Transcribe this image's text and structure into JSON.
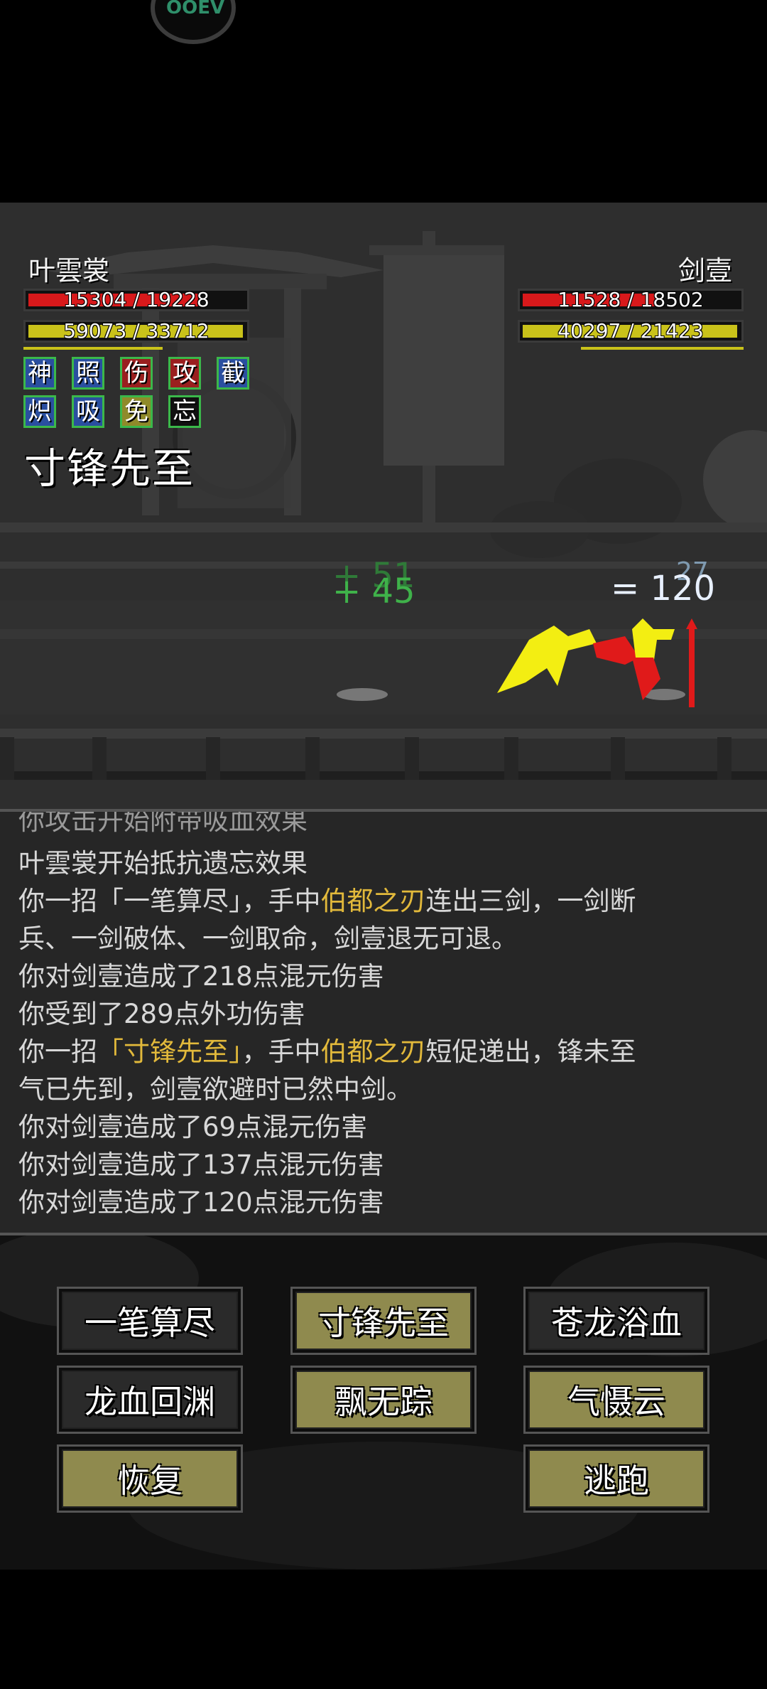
{
  "medal": {
    "text": "OOEV"
  },
  "player": {
    "name": "叶雲裳",
    "hp": "15304 / 19228",
    "hp_fraction": 0.79,
    "mp": "59073 / 33712",
    "mp_fraction": 1.0
  },
  "enemy": {
    "name": "剑壹",
    "hp": "11528 / 18502",
    "hp_fraction": 0.62,
    "mp": "40297 / 21423",
    "mp_fraction": 1.0
  },
  "buffs": [
    {
      "char": "神",
      "color": "#2a4fa0"
    },
    {
      "char": "照",
      "color": "#2a4fa0"
    },
    {
      "char": "伤",
      "color": "#9a1f1f"
    },
    {
      "char": "攻",
      "color": "#9a1f1f"
    },
    {
      "char": "截",
      "color": "#2a4fa0"
    },
    {
      "char": "炽",
      "color": "#2a4fa0"
    },
    {
      "char": "吸",
      "color": "#2a4fa0"
    },
    {
      "char": "免",
      "color": "#8f8a2a"
    },
    {
      "char": "忘",
      "color": "#111111"
    }
  ],
  "current_skill": "寸锋先至",
  "floating": {
    "heal_a": "+ 51",
    "heal_b": "+ 45",
    "damage_a": "= 120",
    "damage_b": "27"
  },
  "log": {
    "line0": "你攻击开始附带吸血效果",
    "line1": "叶雲裳开始抵抗遗忘效果",
    "line2_a": "你一招「一笔算尽」，手中",
    "line2_b": "伯都之刃",
    "line2_c": "连出三剑，一剑断",
    "line3": "兵、一剑破体、一剑取命，剑壹退无可退。",
    "line4": "你对剑壹造成了218点混元伤害",
    "line5": "你受到了289点外功伤害",
    "line6_a": "你一招",
    "line6_b": "「寸锋先至」",
    "line6_c": "，手中",
    "line6_d": "伯都之刃",
    "line6_e": "短促递出，锋未至",
    "line7": "气已先到，剑壹欲避时已然中剑。",
    "line8": "你对剑壹造成了69点混元伤害",
    "line9": "你对剑壹造成了137点混元伤害",
    "line10": "你对剑壹造成了120点混元伤害"
  },
  "buttons": {
    "b1": "一笔算尽",
    "b2": "寸锋先至",
    "b3": "苍龙浴血",
    "b4": "龙血回渊",
    "b5": "飘无踪",
    "b6": "气慑云",
    "b7": "恢复",
    "b8": "逃跑"
  },
  "colors": {
    "hp_bar": "#d8191b",
    "mp_bar": "#c9c21a",
    "button_olive": "#8f8a4e",
    "button_dark": "#2a2a2a",
    "highlight": "#e2b93b",
    "heal_text": "#3fb24a"
  }
}
